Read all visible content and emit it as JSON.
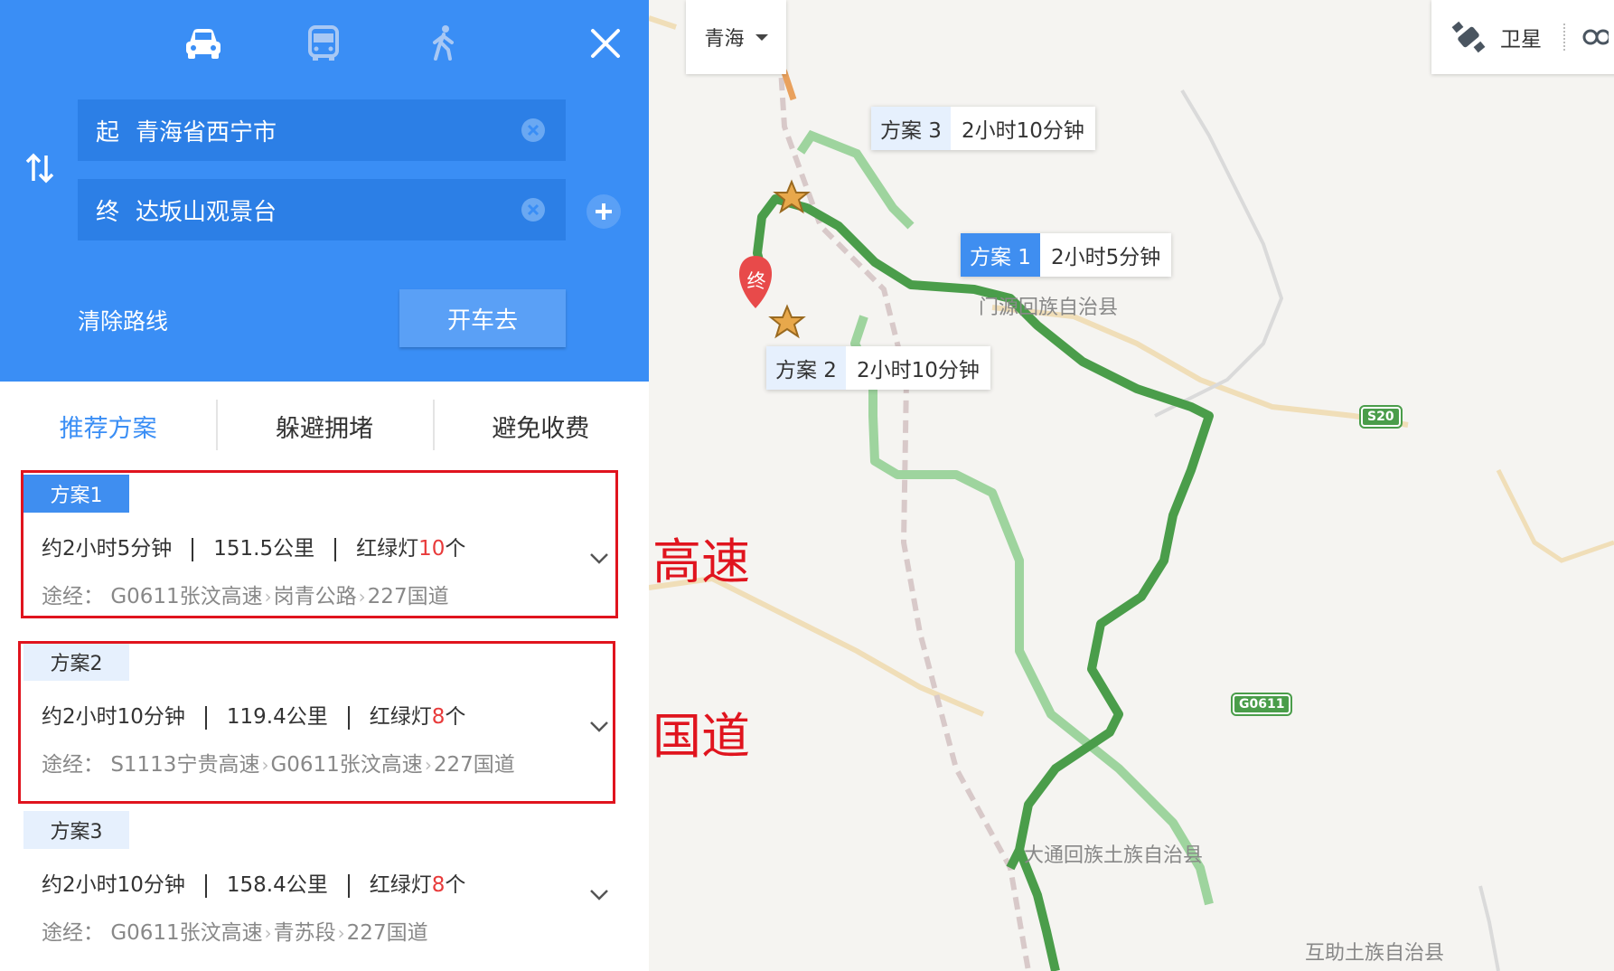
{
  "panel": {
    "modes": [
      "car-icon",
      "bus-icon",
      "walk-icon"
    ],
    "start": {
      "tag": "起",
      "value": "青海省西宁市"
    },
    "end": {
      "tag": "终",
      "value": "达坂山观景台"
    },
    "clear_route": "清除路线",
    "go_button": "开车去",
    "tabs": [
      {
        "label": "推荐方案",
        "active": true
      },
      {
        "label": "躲避拥堵",
        "active": false
      },
      {
        "label": "避免收费",
        "active": false
      }
    ],
    "plans": [
      {
        "badge": "方案1",
        "time": "约2小时5分钟",
        "distance": "151.5公里",
        "lights_prefix": "红绿灯",
        "lights": "10",
        "lights_suffix": "个",
        "via_label": "途经：",
        "via": [
          "G0611张汶高速",
          "岗青公路",
          "227国道"
        ]
      },
      {
        "badge": "方案2",
        "time": "约2小时10分钟",
        "distance": "119.4公里",
        "lights_prefix": "红绿灯",
        "lights": "8",
        "lights_suffix": "个",
        "via_label": "途经：",
        "via": [
          "S1113宁贵高速",
          "G0611张汶高速",
          "227国道"
        ]
      },
      {
        "badge": "方案3",
        "time": "约2小时10分钟",
        "distance": "158.4公里",
        "lights_prefix": "红绿灯",
        "lights": "8",
        "lights_suffix": "个",
        "via_label": "途经：",
        "via": [
          "G0611张汶高速",
          "青苏段",
          "227国道"
        ]
      }
    ]
  },
  "map": {
    "region": "青海",
    "layer_label": "卫星",
    "route_labels": [
      {
        "name": "方案 3",
        "time": "2小时10分钟"
      },
      {
        "name": "方案 1",
        "time": "2小时5分钟"
      },
      {
        "name": "方案 2",
        "time": "2小时10分钟"
      }
    ],
    "end_marker": "终",
    "towns": [
      "门源回族自治县",
      "大通回族土族自治县",
      "互助土族自治县"
    ],
    "shields": [
      "S20",
      "G0611"
    ]
  },
  "annotations": {
    "highway": "高速",
    "national_road": "国道"
  },
  "colors": {
    "panel_blue": "#3a8ef5",
    "route_active": "#4a9d4a",
    "route_alt": "#8fcf8f",
    "highlight": "#e0141e",
    "traffic_red": "#e83a3a"
  }
}
